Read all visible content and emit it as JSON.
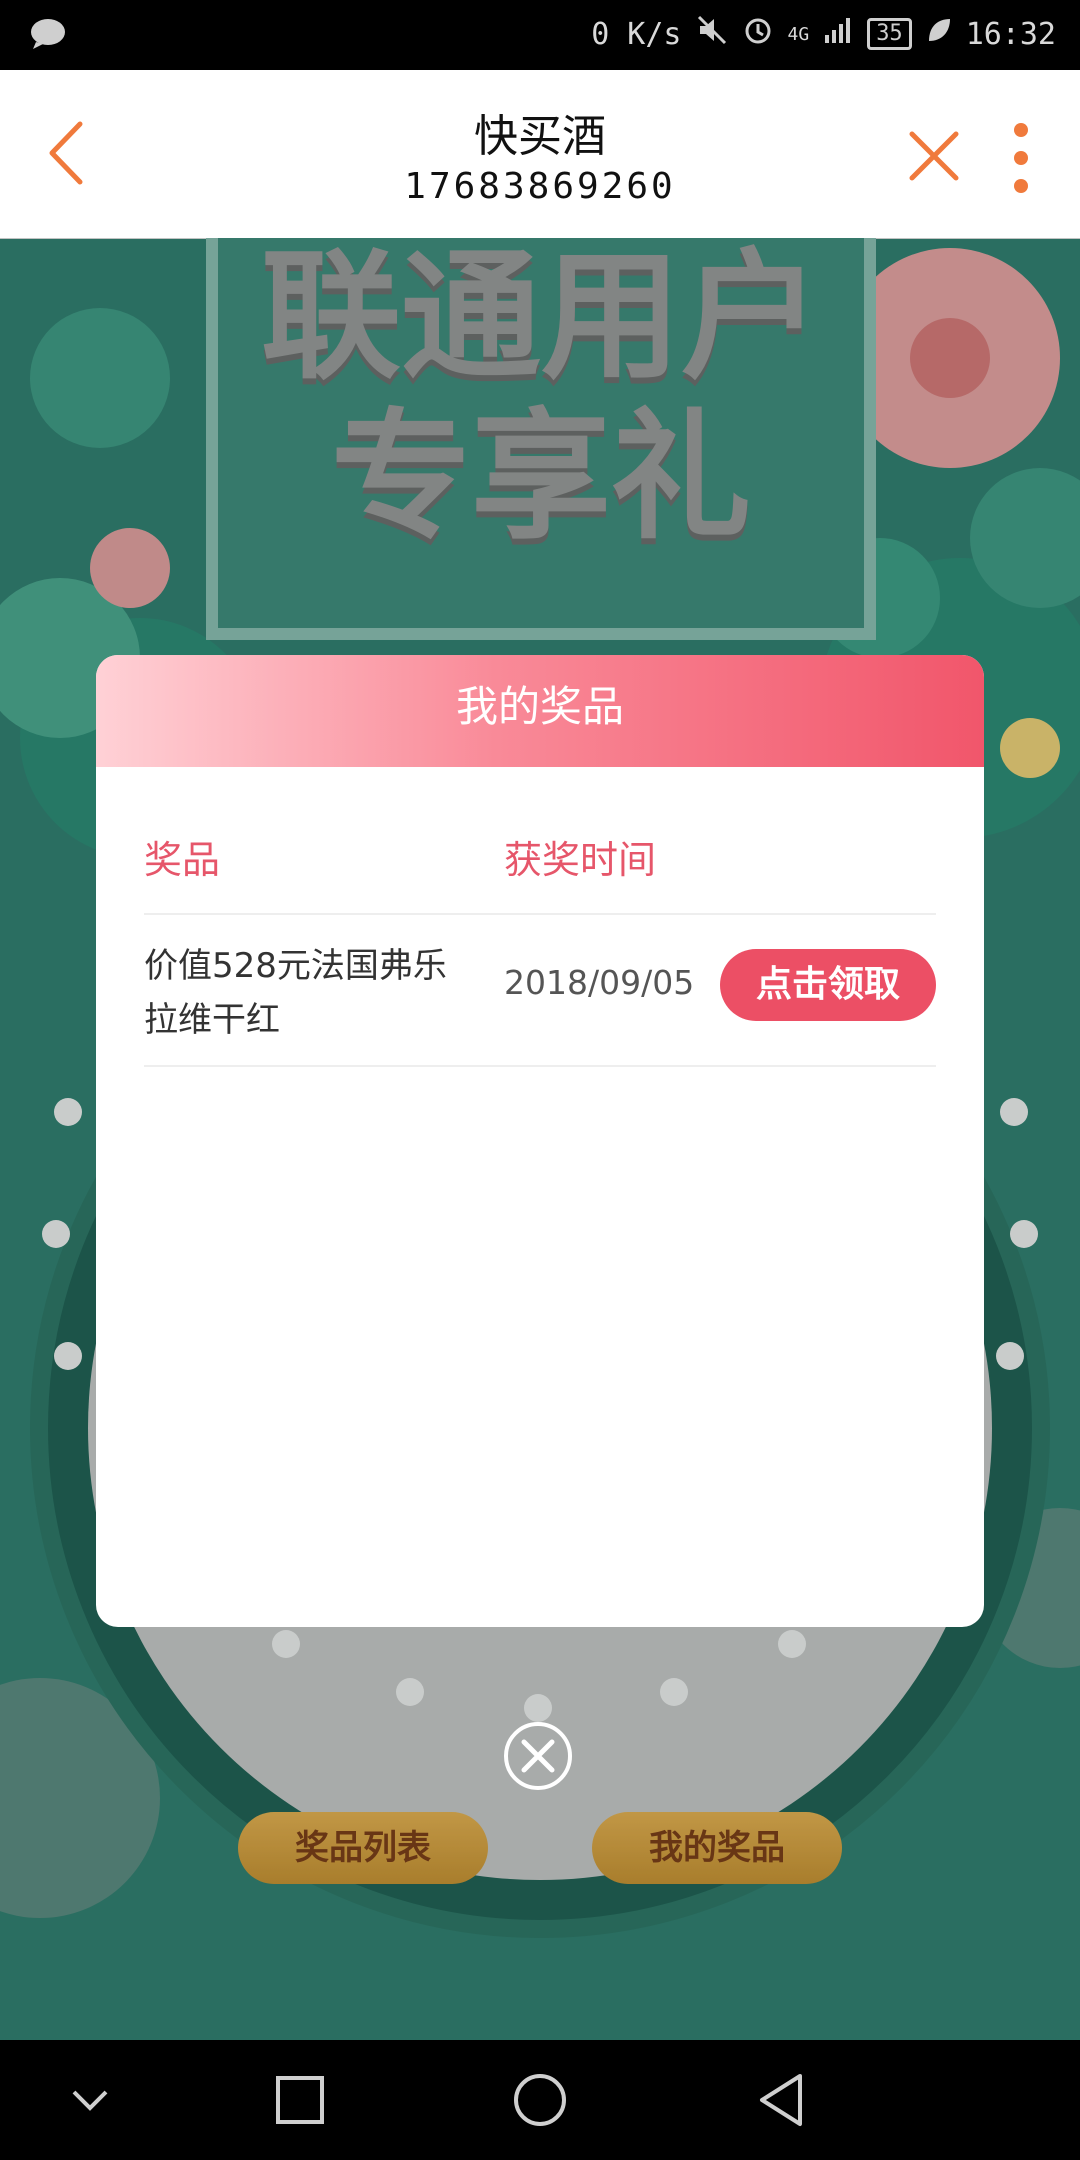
{
  "status_bar": {
    "network_speed": "0 K/s",
    "signal": "4G",
    "battery": "35",
    "time": "16:32",
    "icons": [
      "message-icon",
      "mute-icon",
      "alarm-icon",
      "signal-icon",
      "battery-icon",
      "leaf-icon"
    ]
  },
  "header": {
    "title": "快买酒",
    "subtitle": "17683869260",
    "back_icon": "back-icon",
    "close_icon": "close-icon",
    "more_icon": "more-icon",
    "accent_color": "#f07a3c"
  },
  "banner": {
    "line1": "联通用户",
    "line2": "专享礼"
  },
  "bottom_buttons": {
    "prize_list": "奖品列表",
    "my_prizes": "我的奖品"
  },
  "modal": {
    "title": "我的奖品",
    "columns": [
      "奖品",
      "获奖时间"
    ],
    "rows": [
      {
        "prize_line1": "价值528元法国弗乐",
        "prize_line2": "拉维干红",
        "date": "2018/09/05",
        "action": "点击领取"
      }
    ],
    "close_icon": "close-circle-icon",
    "accent_color": "#ec4f65"
  },
  "nav_bar": {
    "icons": [
      "chevron-down-icon",
      "recent-apps-icon",
      "home-icon",
      "back-triangle-icon"
    ]
  }
}
